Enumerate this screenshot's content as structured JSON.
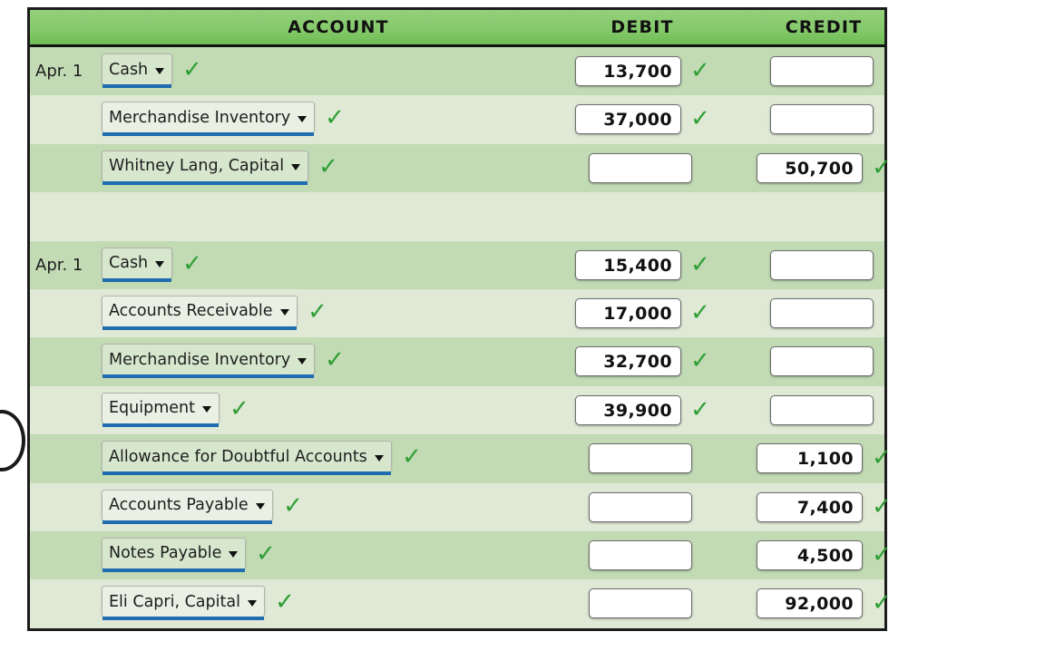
{
  "table": {
    "headers": {
      "account": "ACCOUNT",
      "debit": "DEBIT",
      "credit": "CREDIT"
    },
    "accent_colors": {
      "header_green_top": "#93d07a",
      "header_green_bottom": "#6fbd55",
      "row_dark": "#c2dbb5",
      "row_light": "#dfe9d5",
      "check_green": "#2f9e34",
      "select_underline_blue": "#1f6cb0",
      "border_black": "#1c1c1c"
    },
    "icons": {
      "dropdown": "chevron-down-icon",
      "valid": "green-check-icon",
      "edge": "circle-arc-decoration"
    },
    "rows": [
      {
        "date": "Apr. 1",
        "account": "Cash",
        "account_valid": true,
        "debit": "13,700",
        "debit_valid": true,
        "credit": "",
        "credit_valid": false,
        "shade": "dark",
        "spacer": false
      },
      {
        "date": "",
        "account": "Merchandise Inventory",
        "account_valid": true,
        "debit": "37,000",
        "debit_valid": true,
        "credit": "",
        "credit_valid": false,
        "shade": "light",
        "spacer": false
      },
      {
        "date": "",
        "account": "Whitney Lang, Capital",
        "account_valid": true,
        "debit": "",
        "debit_valid": false,
        "credit": "50,700",
        "credit_valid": true,
        "shade": "dark",
        "spacer": false
      },
      {
        "date": "",
        "account": "",
        "account_valid": false,
        "debit": "",
        "debit_valid": false,
        "credit": "",
        "credit_valid": false,
        "shade": "light",
        "spacer": true
      },
      {
        "date": "Apr. 1",
        "account": "Cash",
        "account_valid": true,
        "debit": "15,400",
        "debit_valid": true,
        "credit": "",
        "credit_valid": false,
        "shade": "dark",
        "spacer": false
      },
      {
        "date": "",
        "account": "Accounts Receivable",
        "account_valid": true,
        "debit": "17,000",
        "debit_valid": true,
        "credit": "",
        "credit_valid": false,
        "shade": "light",
        "spacer": false
      },
      {
        "date": "",
        "account": "Merchandise Inventory",
        "account_valid": true,
        "debit": "32,700",
        "debit_valid": true,
        "credit": "",
        "credit_valid": false,
        "shade": "dark",
        "spacer": false
      },
      {
        "date": "",
        "account": "Equipment",
        "account_valid": true,
        "debit": "39,900",
        "debit_valid": true,
        "credit": "",
        "credit_valid": false,
        "shade": "light",
        "spacer": false
      },
      {
        "date": "",
        "account": "Allowance for Doubtful Accounts",
        "account_valid": true,
        "debit": "",
        "debit_valid": false,
        "credit": "1,100",
        "credit_valid": true,
        "shade": "dark",
        "spacer": false
      },
      {
        "date": "",
        "account": "Accounts Payable",
        "account_valid": true,
        "debit": "",
        "debit_valid": false,
        "credit": "7,400",
        "credit_valid": true,
        "shade": "light",
        "spacer": false
      },
      {
        "date": "",
        "account": "Notes Payable",
        "account_valid": true,
        "debit": "",
        "debit_valid": false,
        "credit": "4,500",
        "credit_valid": true,
        "shade": "dark",
        "spacer": false
      },
      {
        "date": "",
        "account": "Eli Capri, Capital",
        "account_valid": true,
        "debit": "",
        "debit_valid": false,
        "credit": "92,000",
        "credit_valid": true,
        "shade": "light",
        "spacer": false
      }
    ]
  }
}
